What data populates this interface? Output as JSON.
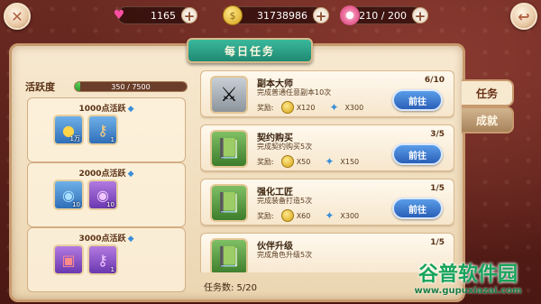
{
  "resources": {
    "gems": "1165",
    "gold": "31738986",
    "stamina": "210 / 200"
  },
  "title": "每日任务",
  "activity": {
    "label": "活跃度",
    "progress_text": "350 / 7500",
    "progress_fraction": 0.0467
  },
  "milestones": [
    {
      "label": "1000点活跃",
      "items": [
        {
          "icon": "gold-coin-icon",
          "count": "1万"
        },
        {
          "icon": "key-icon",
          "count": "1"
        }
      ]
    },
    {
      "label": "2000点活跃",
      "items": [
        {
          "icon": "blue-candy-icon",
          "count": "10"
        },
        {
          "icon": "purple-candy-icon",
          "count": "10"
        }
      ]
    },
    {
      "label": "3000点活跃",
      "items": [
        {
          "icon": "treasure-chest-icon",
          "count": ""
        },
        {
          "icon": "purple-key-icon",
          "count": "1"
        }
      ]
    }
  ],
  "reward_label": "奖励:",
  "go_label": "前往",
  "tasks": [
    {
      "name": "副本大师",
      "desc": "完成普通任意副本10次",
      "progress": "6/10",
      "coins": "X120",
      "gems": "X300",
      "icon": "axe-icon"
    },
    {
      "name": "契约购买",
      "desc": "完成契约购买5次",
      "progress": "3/5",
      "coins": "X50",
      "gems": "X150",
      "icon": "contract-book-icon"
    },
    {
      "name": "强化工匠",
      "desc": "完成装备打造5次",
      "progress": "1/5",
      "coins": "X60",
      "gems": "X300",
      "icon": "forge-book-icon"
    },
    {
      "name": "伙伴升级",
      "desc": "完成角色升级5次",
      "progress": "1/5",
      "coins": "",
      "gems": "",
      "icon": "partner-book-icon"
    }
  ],
  "task_count": "任务数:  5/20",
  "side_tabs": {
    "active": "任务",
    "inactive": "成就"
  },
  "watermark": {
    "title": "谷普软件园",
    "url": "www.gupuxiazai.com"
  }
}
